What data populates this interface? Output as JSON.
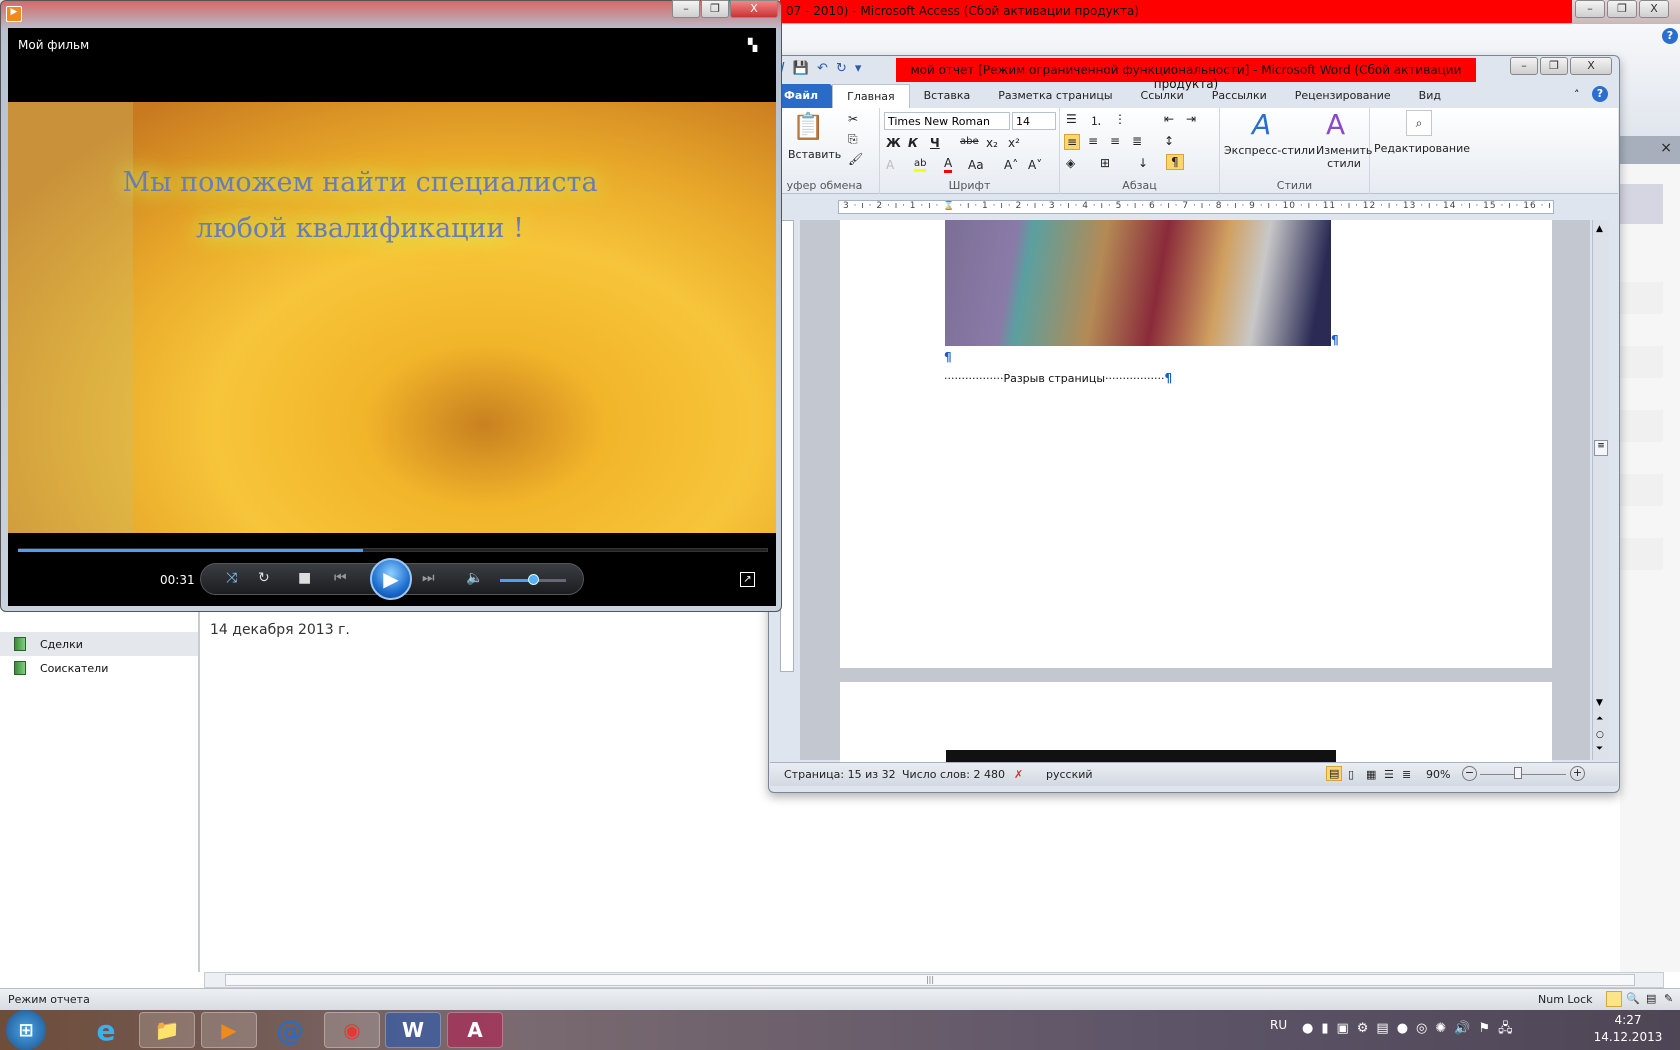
{
  "access": {
    "title": "07 - 2010)  -  Microsoft Access (Сбой активации продукта)",
    "window_controls": [
      "minimize",
      "restore",
      "close"
    ],
    "nav_items": [
      {
        "label": "Сделки",
        "selected": true
      },
      {
        "label": "Соискатели",
        "selected": false
      }
    ],
    "report_date": "14 декабря 2013 г.",
    "status_left": "Режим отчета",
    "status_right": "Num Lock",
    "pane_close": "×",
    "help": "?"
  },
  "player": {
    "title": "Мой фильм",
    "caption_line1": "Мы поможем найти специалиста",
    "caption_line2": "любой квалификации !",
    "time": "00:31",
    "progress_percent": 46,
    "volume_percent": 50,
    "controls": [
      "shuffle",
      "repeat",
      "stop",
      "previous",
      "play",
      "next",
      "mute",
      "volume",
      "fullscreen"
    ]
  },
  "word": {
    "title": "мой отчет [Режим ограниченной функциональности]  -  Microsoft Word (Сбой активации продукта)",
    "tabs": [
      "Файл",
      "Главная",
      "Вставка",
      "Разметка страницы",
      "Ссылки",
      "Рассылки",
      "Рецензирование",
      "Вид"
    ],
    "active_tab": "Главная",
    "font_name": "Times New Roman",
    "font_size": "14",
    "groups": {
      "clipboard": "уфер обмена",
      "font": "Шрифт",
      "paragraph": "Абзац",
      "styles": "Стили"
    },
    "paste_label": "Вставить",
    "express_styles": "Экспресс-стили",
    "change_styles": "Изменить стили",
    "editing": "Редактирование",
    "font_buttons": [
      "Ж",
      "К",
      "Ч",
      "abe",
      "x₂",
      "x²",
      "A",
      "ab",
      "A",
      "Aa",
      "A˄",
      "A˅"
    ],
    "ruler": "3 · ı · 2 · ı · 1 · ı · ⌛ · ı · 1 · ı · 2 · ı · 3 · ı · 4 · ı · 5 · ı · 6 · ı · 7 · ı · 8 · ı · 9 · ı · 10 · ı · 11 · ı · 12 · ı · 13 · ı · 14 · ı · 15 · ı · 16 · ı · 17 · ı ·",
    "pilcrow": "¶",
    "page_break": "·················Разрыв страницы·················",
    "status": {
      "page": "Страница: 15 из 32",
      "words": "Число слов: 2 480",
      "language": "русский",
      "zoom": "90%"
    },
    "zoom_percent": 90
  },
  "taskbar": {
    "apps": [
      "start",
      "internet-explorer",
      "explorer",
      "media-player",
      "mail-agent",
      "chrome",
      "word",
      "access"
    ],
    "lang": "RU",
    "time": "4:27",
    "date": "14.12.2013"
  }
}
